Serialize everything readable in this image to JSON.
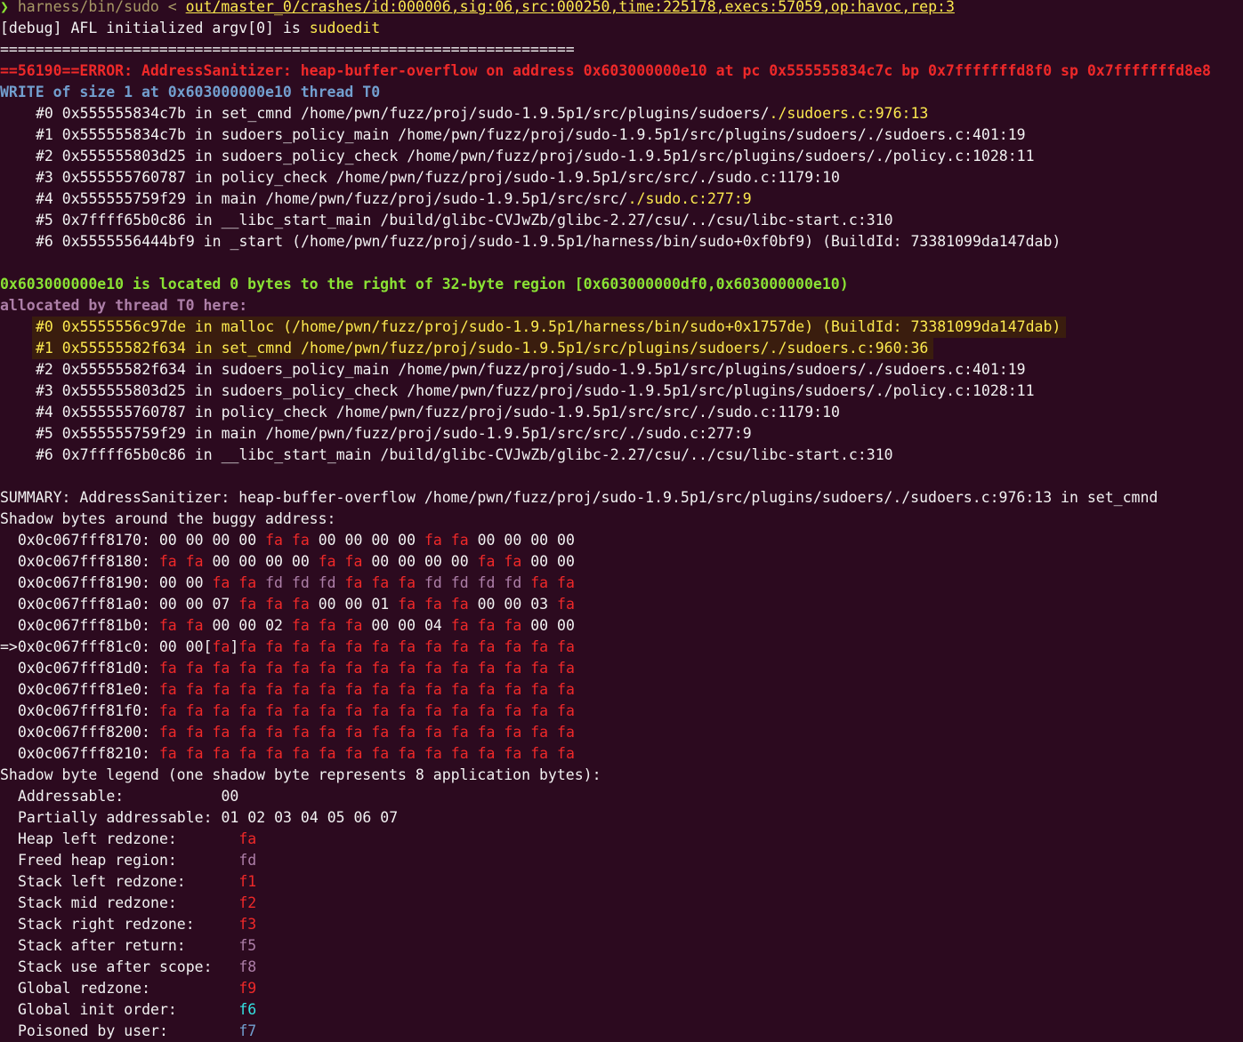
{
  "command": {
    "prompt_glyph": "❯",
    "binary": "harness/bin/sudo",
    "redirect": "<",
    "input_file": "out/master_0/crashes/id:000006,sig:06,src:000250,time:225178,execs:57059,op:havoc,rep:3"
  },
  "debug": {
    "prefix": "[debug] AFL initialized argv[0] is ",
    "value": "sudoedit"
  },
  "separator": "=================================================================",
  "error_line": "==56190==ERROR: AddressSanitizer: heap-buffer-overflow on address 0x603000000e10 at pc 0x555555834c7c bp 0x7fffffffd8f0 sp 0x7fffffffd8e8",
  "write_line": "WRITE of size 1 at 0x603000000e10 thread T0",
  "write_trace": [
    {
      "pre": "#0 0x555555834c7b in set_cmnd /home/pwn/fuzz/proj/sudo-1.9.5p1/src/plugins/sudoers/",
      "hl": "./sudoers.c:976:13"
    },
    {
      "pre": "#1 0x555555834c7b in sudoers_policy_main /home/pwn/fuzz/proj/sudo-1.9.5p1/src/plugins/sudoers/./sudoers.c:401:19",
      "hl": ""
    },
    {
      "pre": "#2 0x555555803d25 in sudoers_policy_check /home/pwn/fuzz/proj/sudo-1.9.5p1/src/plugins/sudoers/./policy.c:1028:11",
      "hl": ""
    },
    {
      "pre": "#3 0x555555760787 in policy_check /home/pwn/fuzz/proj/sudo-1.9.5p1/src/src/./sudo.c:1179:10",
      "hl": ""
    },
    {
      "pre": "#4 0x555555759f29 in main /home/pwn/fuzz/proj/sudo-1.9.5p1/src/src/",
      "hl": "./sudo.c:277:9"
    },
    {
      "pre": "#5 0x7ffff65b0c86 in __libc_start_main /build/glibc-CVJwZb/glibc-2.27/csu/../csu/libc-start.c:310",
      "hl": ""
    },
    {
      "pre": "#6 0x5555556444bf9 in _start (/home/pwn/fuzz/proj/sudo-1.9.5p1/harness/bin/sudo+0xf0bf9) (BuildId: 73381099da147dab)",
      "hl": ""
    }
  ],
  "located_line": "0x603000000e10 is located 0 bytes to the right of 32-byte region [0x603000000df0,0x603000000e10)",
  "allocated_line": "allocated by thread T0 here:",
  "alloc_trace_hl": [
    "#0 0x5555556c97de in malloc (/home/pwn/fuzz/proj/sudo-1.9.5p1/harness/bin/sudo+0x1757de) (BuildId: 73381099da147dab)",
    "#1 0x55555582f634 in set_cmnd /home/pwn/fuzz/proj/sudo-1.9.5p1/src/plugins/sudoers/./sudoers.c:960:36"
  ],
  "alloc_trace": [
    "#2 0x55555582f634 in sudoers_policy_main /home/pwn/fuzz/proj/sudo-1.9.5p1/src/plugins/sudoers/./sudoers.c:401:19",
    "#3 0x555555803d25 in sudoers_policy_check /home/pwn/fuzz/proj/sudo-1.9.5p1/src/plugins/sudoers/./policy.c:1028:11",
    "#4 0x555555760787 in policy_check /home/pwn/fuzz/proj/sudo-1.9.5p1/src/src/./sudo.c:1179:10",
    "#5 0x555555759f29 in main /home/pwn/fuzz/proj/sudo-1.9.5p1/src/src/./sudo.c:277:9",
    "#6 0x7ffff65b0c86 in __libc_start_main /build/glibc-CVJwZb/glibc-2.27/csu/../csu/libc-start.c:310"
  ],
  "summary": "SUMMARY: AddressSanitizer: heap-buffer-overflow /home/pwn/fuzz/proj/sudo-1.9.5p1/src/plugins/sudoers/./sudoers.c:976:13 in set_cmnd",
  "shadow_header": "Shadow bytes around the buggy address:",
  "shadow_rows": [
    {
      "addr": "0x0c067fff8170:",
      "bytes": [
        "00",
        "00",
        "00",
        "00",
        "fa",
        "fa",
        "00",
        "00",
        "00",
        "00",
        "fa",
        "fa",
        "00",
        "00",
        "00",
        "00"
      ]
    },
    {
      "addr": "0x0c067fff8180:",
      "bytes": [
        "fa",
        "fa",
        "00",
        "00",
        "00",
        "00",
        "fa",
        "fa",
        "00",
        "00",
        "00",
        "00",
        "fa",
        "fa",
        "00",
        "00"
      ]
    },
    {
      "addr": "0x0c067fff8190:",
      "bytes": [
        "00",
        "00",
        "fa",
        "fa",
        "fd",
        "fd",
        "fd",
        "fa",
        "fa",
        "fa",
        "fd",
        "fd",
        "fd",
        "fd",
        "fa",
        "fa"
      ]
    },
    {
      "addr": "0x0c067fff81a0:",
      "bytes": [
        "00",
        "00",
        "07",
        "fa",
        "fa",
        "fa",
        "00",
        "00",
        "01",
        "fa",
        "fa",
        "fa",
        "00",
        "00",
        "03",
        "fa"
      ]
    },
    {
      "addr": "0x0c067fff81b0:",
      "bytes": [
        "fa",
        "fa",
        "00",
        "00",
        "02",
        "fa",
        "fa",
        "fa",
        "00",
        "00",
        "04",
        "fa",
        "fa",
        "fa",
        "00",
        "00"
      ]
    },
    {
      "addr": "0x0c067fff81c0:",
      "bytes": [
        "00",
        "00",
        "fa",
        "fa",
        "fa",
        "fa",
        "fa",
        "fa",
        "fa",
        "fa",
        "fa",
        "fa",
        "fa",
        "fa",
        "fa",
        "fa"
      ],
      "marker": "=>",
      "bracket_index": 2
    },
    {
      "addr": "0x0c067fff81d0:",
      "bytes": [
        "fa",
        "fa",
        "fa",
        "fa",
        "fa",
        "fa",
        "fa",
        "fa",
        "fa",
        "fa",
        "fa",
        "fa",
        "fa",
        "fa",
        "fa",
        "fa"
      ]
    },
    {
      "addr": "0x0c067fff81e0:",
      "bytes": [
        "fa",
        "fa",
        "fa",
        "fa",
        "fa",
        "fa",
        "fa",
        "fa",
        "fa",
        "fa",
        "fa",
        "fa",
        "fa",
        "fa",
        "fa",
        "fa"
      ]
    },
    {
      "addr": "0x0c067fff81f0:",
      "bytes": [
        "fa",
        "fa",
        "fa",
        "fa",
        "fa",
        "fa",
        "fa",
        "fa",
        "fa",
        "fa",
        "fa",
        "fa",
        "fa",
        "fa",
        "fa",
        "fa"
      ]
    },
    {
      "addr": "0x0c067fff8200:",
      "bytes": [
        "fa",
        "fa",
        "fa",
        "fa",
        "fa",
        "fa",
        "fa",
        "fa",
        "fa",
        "fa",
        "fa",
        "fa",
        "fa",
        "fa",
        "fa",
        "fa"
      ]
    },
    {
      "addr": "0x0c067fff8210:",
      "bytes": [
        "fa",
        "fa",
        "fa",
        "fa",
        "fa",
        "fa",
        "fa",
        "fa",
        "fa",
        "fa",
        "fa",
        "fa",
        "fa",
        "fa",
        "fa",
        "fa"
      ]
    }
  ],
  "legend_header": "Shadow byte legend (one shadow byte represents 8 application bytes):",
  "legend": [
    {
      "label": "Addressable:           ",
      "value": "00",
      "color": "plain"
    },
    {
      "label": "Partially addressable: ",
      "value": "01 02 03 04 05 06 07",
      "color": "plain"
    },
    {
      "label": "Heap left redzone:       ",
      "value": "fa",
      "color": "red"
    },
    {
      "label": "Freed heap region:       ",
      "value": "fd",
      "color": "magenta"
    },
    {
      "label": "Stack left redzone:      ",
      "value": "f1",
      "color": "red"
    },
    {
      "label": "Stack mid redzone:       ",
      "value": "f2",
      "color": "red"
    },
    {
      "label": "Stack right redzone:     ",
      "value": "f3",
      "color": "red"
    },
    {
      "label": "Stack after return:      ",
      "value": "f5",
      "color": "magenta"
    },
    {
      "label": "Stack use after scope:   ",
      "value": "f8",
      "color": "magenta"
    },
    {
      "label": "Global redzone:          ",
      "value": "f9",
      "color": "red"
    },
    {
      "label": "Global init order:       ",
      "value": "f6",
      "color": "cyan"
    },
    {
      "label": "Poisoned by user:        ",
      "value": "f7",
      "color": "blue"
    }
  ]
}
